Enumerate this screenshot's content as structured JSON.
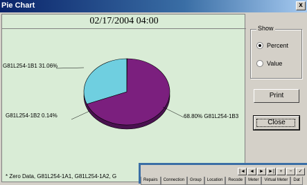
{
  "window": {
    "title": "Pie Chart",
    "close_label": "x"
  },
  "chart": {
    "date": "02/17/2004 04:00",
    "labels": {
      "b1": "G81L254-1B1 31.06%",
      "b2": "G81L254-1B2 0.14%",
      "b3": "68.80% G81L254-1B3"
    },
    "footer": "* Zero Data, G81L254-1A1, G81L254-1A2, G"
  },
  "chart_data": {
    "type": "pie",
    "title": "02/17/2004 04:00",
    "categories": [
      "G81L254-1B1",
      "G81L254-1B2",
      "G81L254-1B3"
    ],
    "values": [
      31.06,
      0.14,
      68.8
    ],
    "colors": [
      "#6fcfe0",
      "#c9c9c9",
      "#7b1f7e"
    ]
  },
  "show": {
    "legend": "Show",
    "percent_label": "Percent",
    "value_label": "Value",
    "selected": "Percent"
  },
  "buttons": {
    "print": "Print",
    "close": "Close"
  },
  "bottom": {
    "nav": [
      "|◄",
      "◄",
      "►",
      "►|",
      "+",
      "−",
      "✓"
    ],
    "tabs": [
      "Repairs",
      "Connection",
      "Group",
      "Location",
      "Recode",
      "Meter",
      "Virtual Meter",
      "Dat"
    ]
  }
}
